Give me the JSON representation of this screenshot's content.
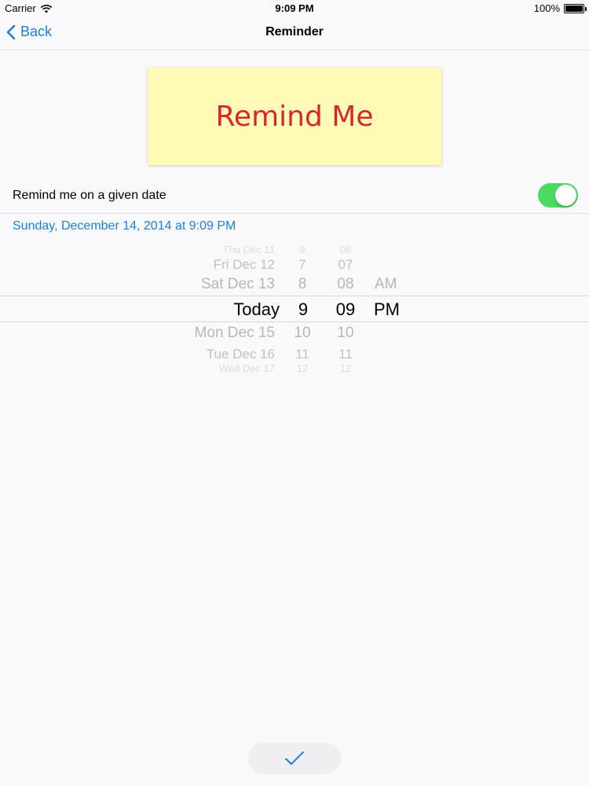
{
  "status_bar": {
    "carrier": "Carrier",
    "time": "9:09 PM",
    "battery": "100%"
  },
  "nav": {
    "back_label": "Back",
    "title": "Reminder"
  },
  "note": {
    "text": "Remind Me"
  },
  "toggle_row": {
    "label": "Remind me on a given date",
    "on": true
  },
  "selected_date": "Sunday, December 14, 2014 at 9:09 PM",
  "picker": {
    "dates": [
      "Thu Dec 11",
      "Fri Dec 12",
      "Sat Dec 13",
      "Today",
      "Mon Dec 15",
      "Tue Dec 16",
      "Wed Dec 17"
    ],
    "hours": [
      "6",
      "7",
      "8",
      "9",
      "10",
      "11",
      "12"
    ],
    "minutes": [
      "06",
      "07",
      "08",
      "09",
      "10",
      "11",
      "12"
    ],
    "ampm": [
      "AM",
      "PM"
    ],
    "selected_index": 3
  },
  "colors": {
    "accent": "#1b7fe0",
    "toggle_on": "#4cd964",
    "note_bg": "#fffbb6",
    "note_text": "#d8262f"
  },
  "icons": {
    "back": "chevron-left-icon",
    "wifi": "wifi-icon",
    "battery": "battery-icon",
    "done": "checkmark-icon"
  }
}
